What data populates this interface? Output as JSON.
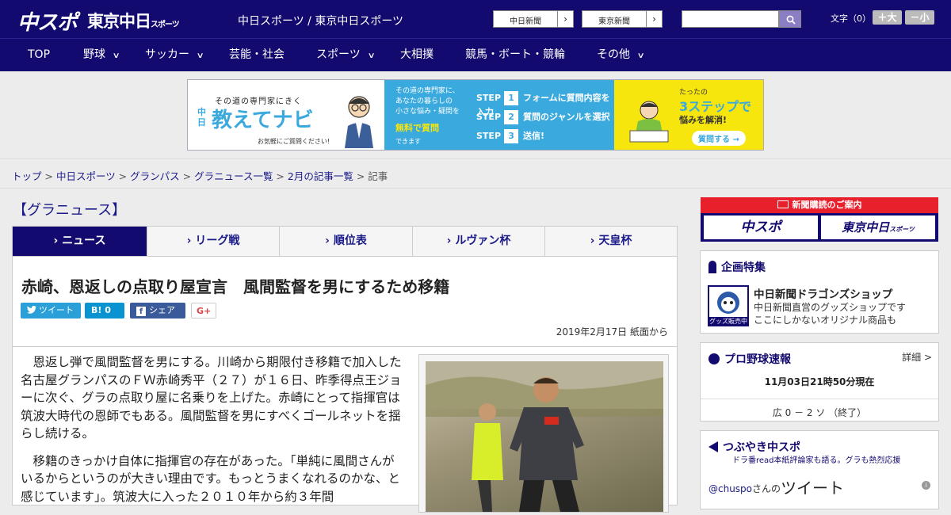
{
  "header": {
    "logo_chuspo": "中スポ",
    "logo_tokyo": "東京中日",
    "logo_tokyo_small": "スポーツ",
    "site_names": "中日スポーツ / 東京中日スポーツ",
    "btn_chunichi": "中日新聞",
    "btn_tokyo": "東京新聞",
    "search_placeholder": "",
    "font_label": "文字（0）",
    "font_larger": "＋大",
    "font_smaller": "－小"
  },
  "nav": [
    {
      "label": "TOP",
      "chevron": false
    },
    {
      "label": "野球",
      "chevron": true
    },
    {
      "label": "サッカー",
      "chevron": true
    },
    {
      "label": "芸能・社会",
      "chevron": false
    },
    {
      "label": "スポーツ",
      "chevron": true
    },
    {
      "label": "大相撲",
      "chevron": false
    },
    {
      "label": "競馬・ボート・競輪",
      "chevron": false
    },
    {
      "label": "その他",
      "chevron": true
    }
  ],
  "ad": {
    "tag": "その道の専門家にきく",
    "chunichi": "中日",
    "brand": "教えてナビ",
    "sub": "お気軽にご質問ください!",
    "mid_text": "その道の専門家に、\nあなたの暮らしの\n小さな悩み・疑問を",
    "mid_highlight": "無料で質問",
    "mid_small": "できます",
    "steps": [
      {
        "num": "1",
        "text": "フォームに質問内容を入力"
      },
      {
        "num": "2",
        "text": "質問のジャンルを選択"
      },
      {
        "num": "3",
        "text": "送信!"
      }
    ],
    "step_word": "STEP",
    "right_small": "たったの",
    "right_big": "3ステップで",
    "right_mid": "悩みを解消!",
    "right_btn": "質問する →"
  },
  "breadcrumb": {
    "items": [
      "トップ",
      "中日スポーツ",
      "グランパス",
      "グラニュース一覧",
      "2月の記事一覧"
    ],
    "current": "記事",
    "sep": " > "
  },
  "section_title": "【グラニュース】",
  "tabs": [
    "› ニュース",
    "› リーグ戦",
    "› 順位表",
    "› ルヴァン杯",
    "› 天皇杯"
  ],
  "article": {
    "headline": "赤崎、恩返しの点取り屋宣言　風間監督を男にするため移籍",
    "tweet": "ツイート",
    "hatena": "B! 0",
    "share": "シェア 3",
    "gplus": "G+",
    "date": "2019年2月17日 紙面から",
    "paragraphs": [
      "恩返し弾で風間監督を男にする。川崎から期限付き移籍で加入した名古屋グランパスのＦＷ赤崎秀平（２７）が１６日、昨季得点王ジョーに次ぐ、グラの点取り屋に名乗りを上げた。赤崎にとって指揮官は筑波大時代の恩師でもある。風間監督を男にすべくゴールネットを揺らし続ける。",
      "移籍のきっかけ自体に指揮官の存在があった。「単純に風間さんがいるからというのが大きい理由です。もっとうまくなれるのかな、と感じています」。筑波大に入った２０１０年から約３年間"
    ]
  },
  "sidebar": {
    "sub_notice": "新聞購読のご案内",
    "sub_chuspo": "中スポ",
    "sub_tokyo": "東京中日",
    "sub_tokyo_small": "スポーツ",
    "feature_title": "企画特集",
    "shop_title": "中日新聞ドラゴンズショップ",
    "shop_desc1": "中日新聞直営のグッズショップです",
    "shop_desc2": "ここにしかないオリジナル商品も",
    "shop_img_label": "グッズ販売中",
    "baseball_title": "プロ野球速報",
    "baseball_detail": "詳細 >",
    "baseball_time": "11月03日21時50分現在",
    "baseball_score": "広 0 － 2 ソ （終了）",
    "tweet_title": "つぶやき中スポ",
    "tweet_sub": "ドラ番read本紙評論家も語る。グラも熱烈応援",
    "tweet_handle": "@chuspo",
    "tweet_san": "さんの",
    "tweet_word": "ツイート"
  },
  "colors": {
    "brand_navy": "#120a6e",
    "link": "#1a1a8a",
    "twitter": "#2a9fd8",
    "hatena": "#0a93d1",
    "facebook": "#3b5a9a",
    "sub_red": "#e8202c",
    "ad_blue": "#3aa9de",
    "ad_yellow": "#f7e60d"
  }
}
